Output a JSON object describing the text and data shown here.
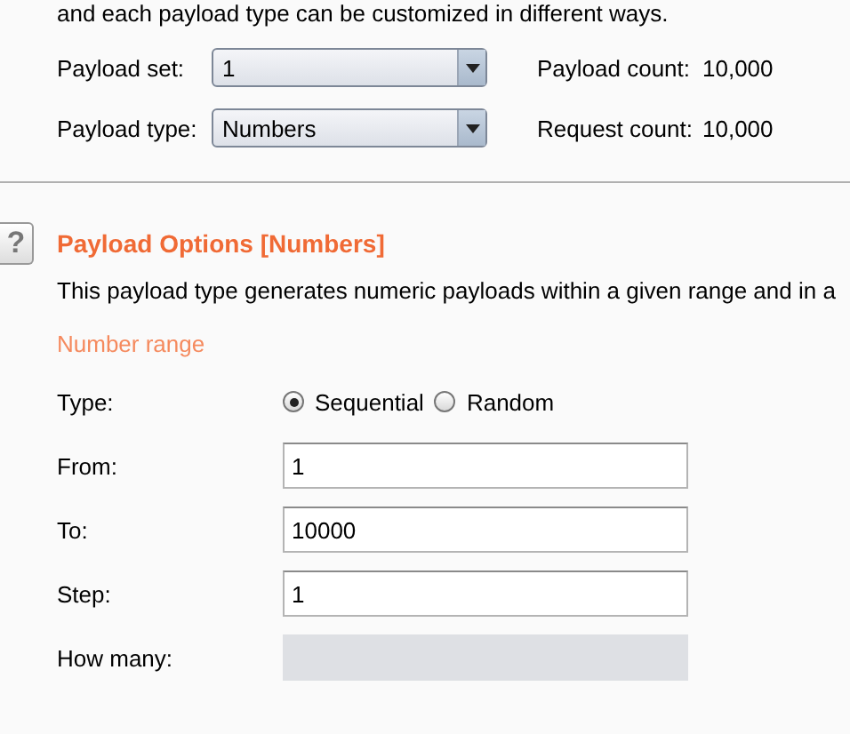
{
  "intro_text": "and each payload type can be customized in different ways.",
  "payload_set": {
    "label": "Payload set:",
    "value": "1"
  },
  "payload_type": {
    "label": "Payload type:",
    "value": "Numbers"
  },
  "payload_count": {
    "label": "Payload count:",
    "value": "10,000"
  },
  "request_count": {
    "label": "Request count:",
    "value": "10,000"
  },
  "section": {
    "help": "?",
    "title": "Payload Options [Numbers]",
    "description": "This payload type generates numeric payloads within a given range and in a"
  },
  "number_range": {
    "heading": "Number range",
    "type": {
      "label": "Type:",
      "options": [
        {
          "label": "Sequential",
          "selected": true
        },
        {
          "label": "Random",
          "selected": false
        }
      ]
    },
    "fields": [
      {
        "label": "From:",
        "value": "1",
        "disabled": false
      },
      {
        "label": "To:",
        "value": "10000",
        "disabled": false
      },
      {
        "label": "Step:",
        "value": "1",
        "disabled": false
      },
      {
        "label": "How many:",
        "disabled": true
      }
    ]
  }
}
